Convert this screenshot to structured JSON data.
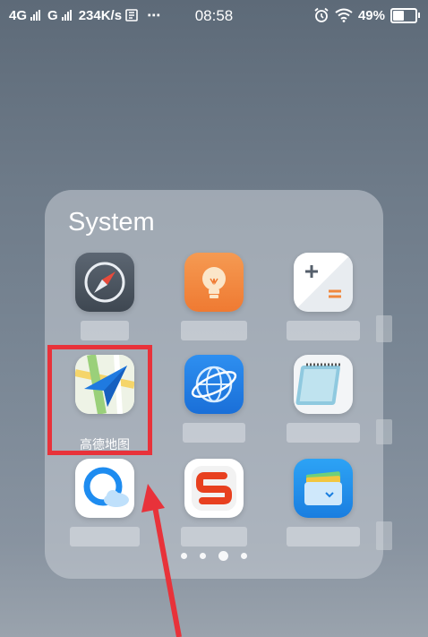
{
  "status_bar": {
    "network1": "4G",
    "network2": "G",
    "speed": "234K/s",
    "time": "08:58",
    "battery": "49%",
    "icons": [
      "signal-icon",
      "notification-icon",
      "more-icon",
      "alarm-icon",
      "wifi-icon",
      "battery-icon"
    ]
  },
  "folder": {
    "title": "System",
    "apps": [
      {
        "name": "compass-app-icon",
        "label": ""
      },
      {
        "name": "lightbulb-app-icon",
        "label": ""
      },
      {
        "name": "calculator-app-icon",
        "label": ""
      },
      {
        "name": "amap-app-icon",
        "label": "高德地图"
      },
      {
        "name": "browser-app-icon",
        "label": ""
      },
      {
        "name": "notepad-app-icon",
        "label": ""
      },
      {
        "name": "cloud-app-icon",
        "label": ""
      },
      {
        "name": "sogou-app-icon",
        "label": ""
      },
      {
        "name": "wallet-app-icon",
        "label": ""
      }
    ],
    "pages": 4,
    "current_page": 3
  },
  "colors": {
    "highlight": "#e8323a",
    "arrow": "#e8323a"
  }
}
